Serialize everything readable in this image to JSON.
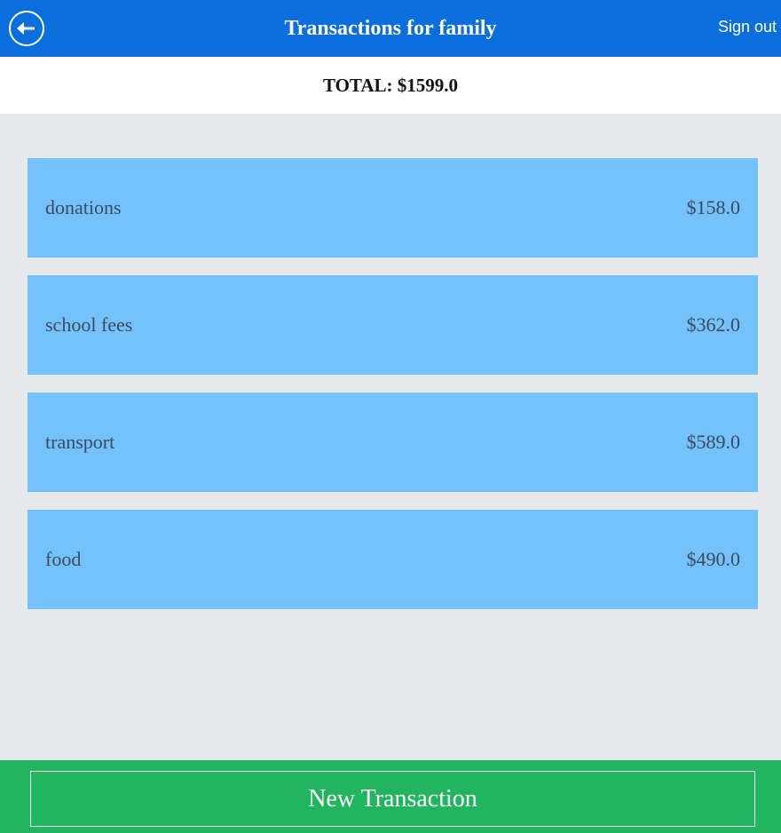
{
  "header": {
    "title": "Transactions for family",
    "signout_label": "Sign out",
    "back_icon": "arrow-left-icon",
    "bg_color": "#0a6fdc"
  },
  "summary": {
    "total_text": "TOTAL: $1599.0"
  },
  "transactions": [
    {
      "category": "donations",
      "amount": "$158.0"
    },
    {
      "category": "school fees",
      "amount": "$362.0"
    },
    {
      "category": "transport",
      "amount": "$589.0"
    },
    {
      "category": "food",
      "amount": "$490.0"
    }
  ],
  "footer": {
    "new_button_label": "New Transaction",
    "bg_color": "#22b55f"
  },
  "colors": {
    "item_bg": "#74c2fd",
    "page_bg": "#e7e8ec"
  }
}
